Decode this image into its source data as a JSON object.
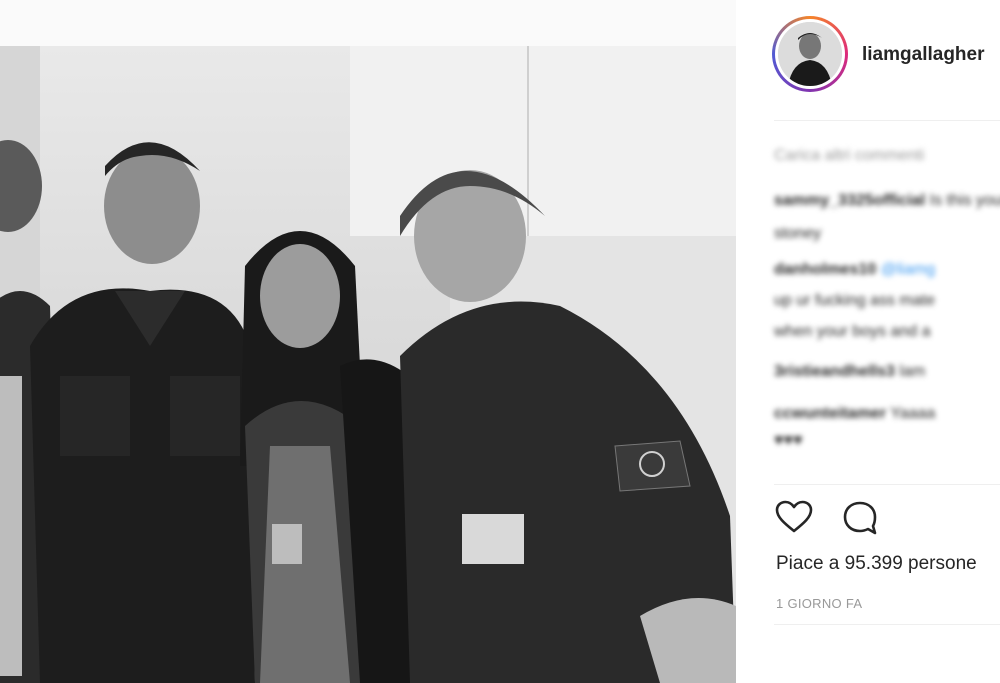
{
  "post": {
    "photo_alt": "Black and white photo of four people posing backstage"
  },
  "header": {
    "username": "liamgallagher",
    "avatar": "user-avatar"
  },
  "comments": {
    "load_more": "Carica altri commenti",
    "items": [
      {
        "user": "sammy_3325official",
        "text": "Is this your",
        "cont": "stoney"
      },
      {
        "user": "danholmes10",
        "text": "@liamg",
        "cont": "up ur fucking ass mate",
        "cont2": "when your boys and a"
      },
      {
        "user": "3ristieandhells3",
        "text": "lam"
      },
      {
        "user": "ccwunteitamer",
        "text": "Yaaaa",
        "cont": "♥♥♥"
      }
    ]
  },
  "actions": {
    "like_icon": "heart-icon",
    "comment_icon": "comment-bubble-icon"
  },
  "likes": {
    "text": "Piace a 95.399 persone"
  },
  "timestamp": {
    "text": "1 GIORNO FA"
  },
  "colors": {
    "text": "#262626",
    "muted": "#999999",
    "link": "#3897f0",
    "divider": "#efefef"
  }
}
